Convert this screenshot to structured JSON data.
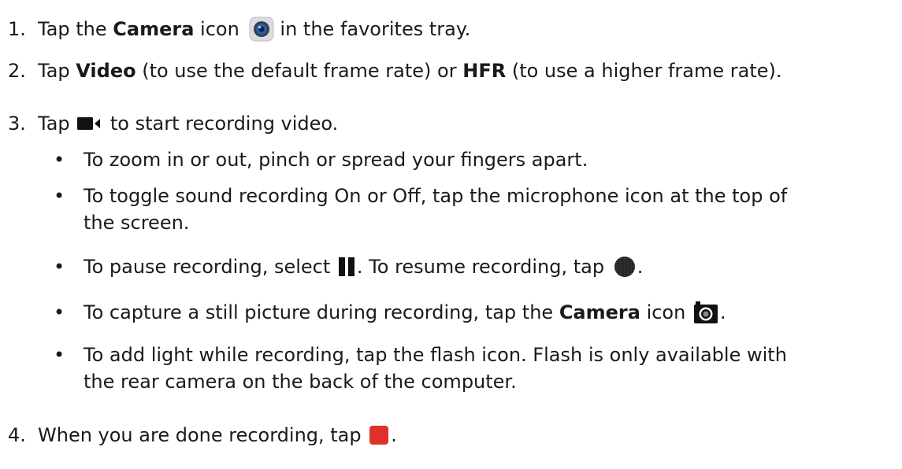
{
  "steps": [
    {
      "number": "1.",
      "pre": "Tap the ",
      "bold": "Camera",
      "mid": " icon",
      "icon": "camera-app-icon",
      "post": " in the favorites tray."
    },
    {
      "number": "2.",
      "pre": "Tap ",
      "bold1": "Video",
      "mid": " (to use the default frame rate) or ",
      "bold2": "HFR",
      "post": " (to use a higher frame rate)."
    },
    {
      "number": "3.",
      "pre": "Tap ",
      "icon": "video-record-icon",
      "post": " to start recording video."
    },
    {
      "number": "4.",
      "pre": "When you are done recording, tap ",
      "icon": "stop-icon",
      "post": "."
    }
  ],
  "bullets": [
    {
      "symbol": "•",
      "text": "To zoom in or out, pinch or spread your fingers apart."
    },
    {
      "symbol": "•",
      "line1": "To toggle sound recording On or Off, tap the microphone icon at the top of",
      "line2": "the screen."
    },
    {
      "symbol": "•",
      "pre": "To pause recording, select ",
      "icon1": "pause-icon",
      "mid": ". To resume recording, tap ",
      "icon2": "record-resume-icon",
      "post": "."
    },
    {
      "symbol": "•",
      "pre": "To capture a still picture during recording, tap the ",
      "bold": "Camera",
      "mid": " icon ",
      "icon": "still-camera-icon",
      "post": "."
    },
    {
      "symbol": "•",
      "line1": "To add light while recording, tap the flash icon. Flash is only available with",
      "line2": "the rear camera on the back of the computer."
    }
  ],
  "colors": {
    "text": "#1a1a1a",
    "stop_red": "#e0302a",
    "camera_blue": "#2a5db0"
  }
}
